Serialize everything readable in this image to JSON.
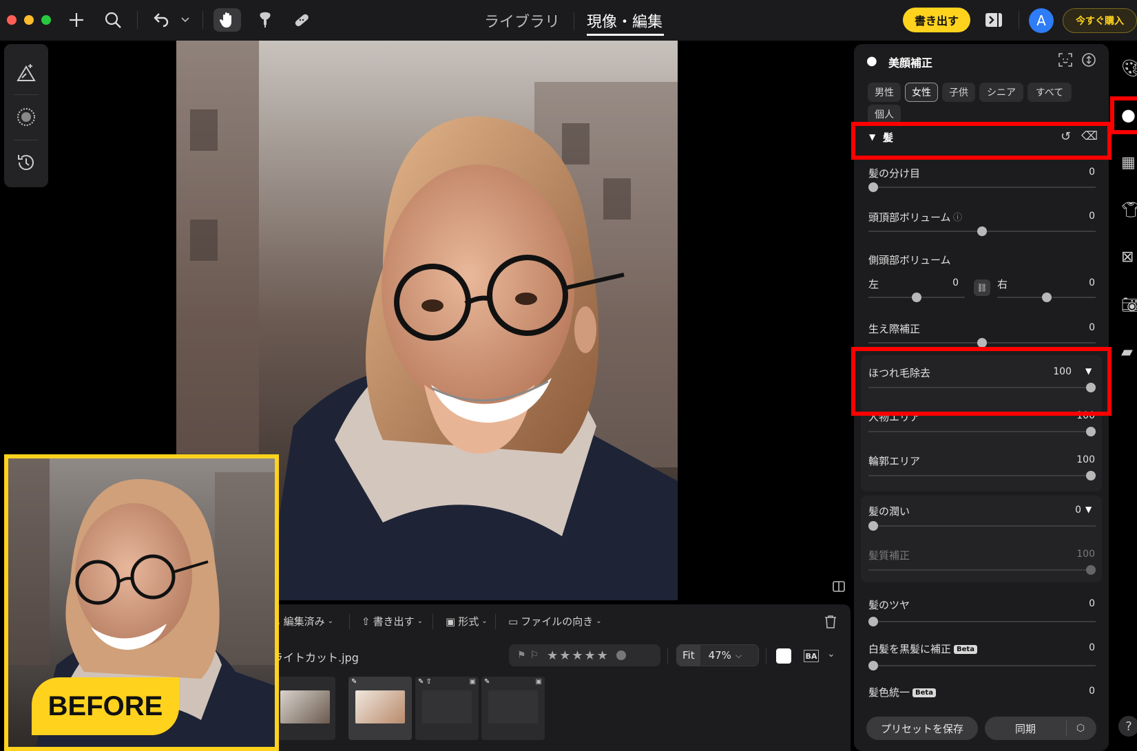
{
  "topbar": {
    "tabs": [
      "ライブラリ",
      "現像・編集"
    ],
    "export_label": "書き出す",
    "buy_label": "今すぐ購入",
    "avatar_letter": "A"
  },
  "colors": {
    "accent_yellow": "#ffd21e",
    "highlight_red": "#ff0000",
    "avatar_blue": "#2e7cf6",
    "panel_bg": "#1c1c1e"
  },
  "filmbar": {
    "menu": [
      "編集済み",
      "書き出す",
      "形式",
      "ファイルの向き"
    ],
    "filename": "ライトカット.jpg",
    "rating_stars": 5,
    "fit_label": "Fit",
    "zoom": "47%",
    "ba_label": "BA"
  },
  "before_label": "BEFORE",
  "panel": {
    "title": "美顔補正",
    "chips": [
      "男性",
      "女性",
      "子供",
      "シニア",
      "すべて",
      "個人"
    ],
    "selected_chip": "女性",
    "section": "髪",
    "sliders": {
      "parting": {
        "label": "髪の分け目",
        "value": "0",
        "fraction": 0.0
      },
      "crown": {
        "label": "頭頂部ボリューム",
        "value": "0",
        "fraction": 0.5
      },
      "side_title": "側頭部ボリューム",
      "side_left": {
        "label": "左",
        "value": "0",
        "fraction": 0.5
      },
      "side_right": {
        "label": "右",
        "value": "0",
        "fraction": 0.5
      },
      "hairline": {
        "label": "生え際補正",
        "value": "0",
        "fraction": 0.5
      },
      "flyaway": {
        "label": "ほつれ毛除去",
        "value": "100",
        "fraction": 1.0
      },
      "person_area": {
        "label": "人物エリア",
        "value": "100",
        "fraction": 1.0
      },
      "contour_area": {
        "label": "輪郭エリア",
        "value": "100",
        "fraction": 1.0
      },
      "moisture": {
        "label": "髪の潤い",
        "value": "0",
        "fraction": 0.0
      },
      "texture": {
        "label": "髪質補正",
        "value": "100",
        "fraction": 1.0
      },
      "gloss": {
        "label": "髪のツヤ",
        "value": "0",
        "fraction": 0.0
      },
      "gray_to_black": {
        "label": "白髪を黒髪に補正",
        "value": "0",
        "fraction": 0.0
      },
      "color_unify": {
        "label": "髪色統一",
        "value": "0",
        "fraction": 0.0
      }
    },
    "beta_tag": "Beta",
    "save_preset": "プリセットを保存",
    "sync": "同期"
  },
  "help": "?"
}
